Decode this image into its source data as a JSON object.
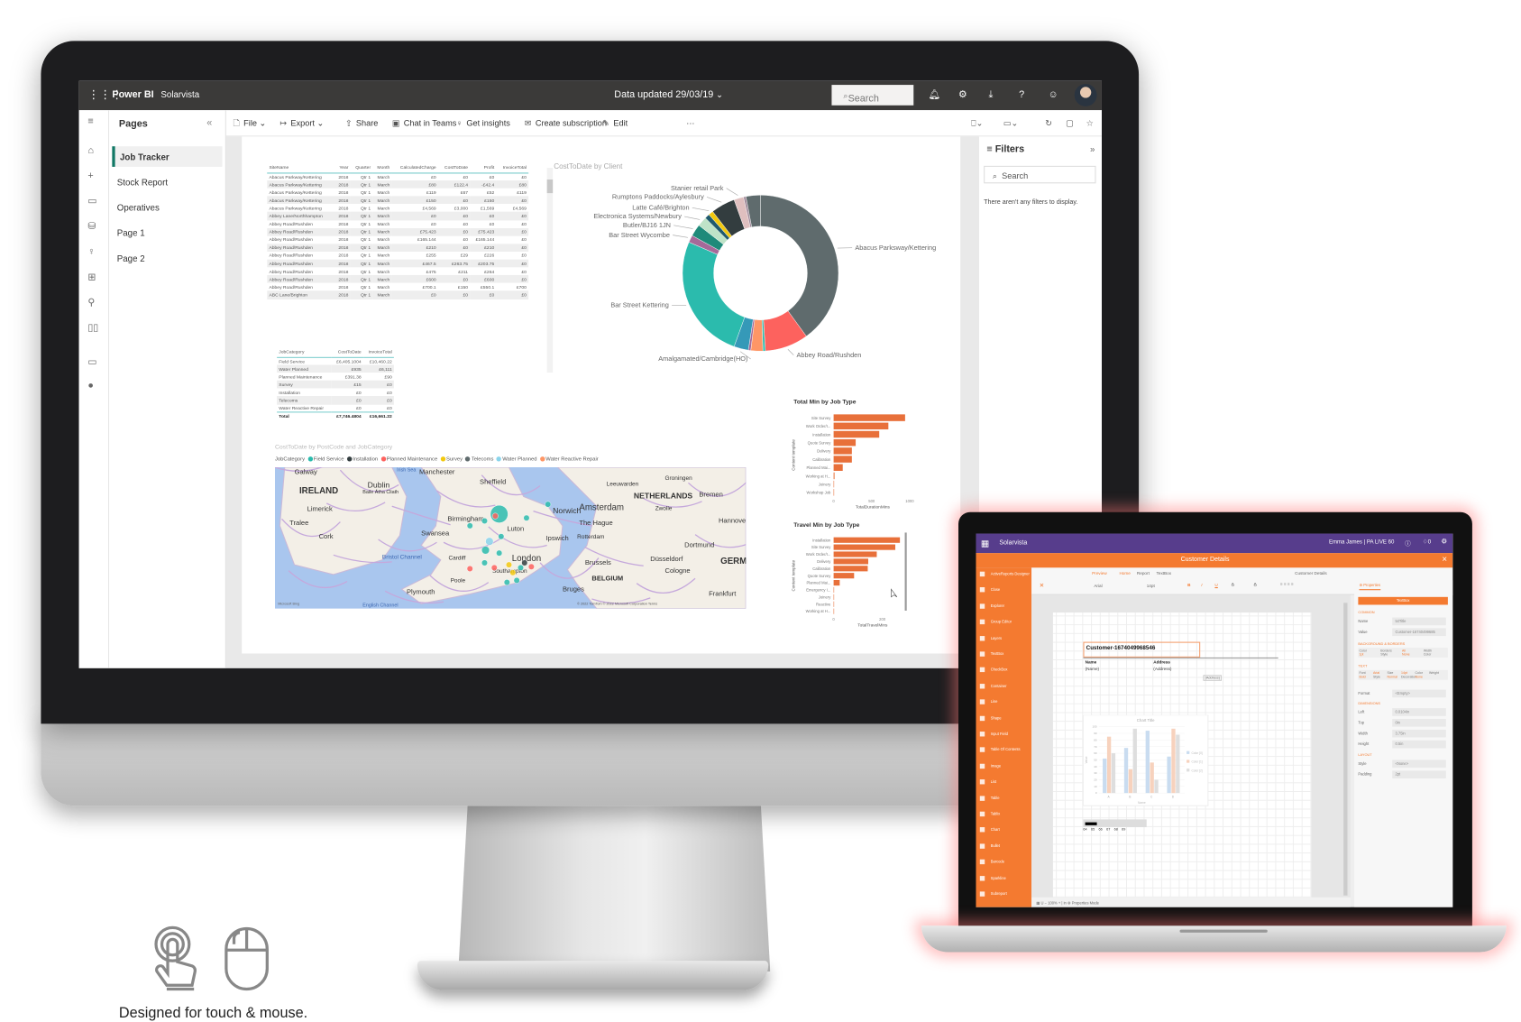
{
  "monitor": {
    "topbar": {
      "grid_icon": "waffle-icon",
      "brand": "Power BI",
      "workspace": "Solarvista",
      "data_updated": "Data updated 29/03/19",
      "search_placeholder": "Search",
      "icons": [
        "bell-icon",
        "gear-icon",
        "download-icon",
        "help-icon",
        "smiley-icon",
        "avatar"
      ]
    },
    "rail_icons": [
      "hamburger-icon",
      "home-icon",
      "plus-icon",
      "folder-icon",
      "database-icon",
      "lightbulb-icon",
      "apps-icon",
      "rocket-icon",
      "book-icon",
      "monitor-icon",
      "user-circle-icon"
    ],
    "pages": {
      "title": "Pages",
      "collapse": "«",
      "items": [
        {
          "label": "Job Tracker",
          "selected": true
        },
        {
          "label": "Stock Report"
        },
        {
          "label": "Operatives"
        },
        {
          "label": "Page 1"
        },
        {
          "label": "Page 2"
        }
      ]
    },
    "toolbar": {
      "items": [
        {
          "icon": "file-icon",
          "label": "File ⌄"
        },
        {
          "icon": "export-icon",
          "label": "Export ⌄"
        },
        {
          "icon": "share-icon",
          "label": "Share"
        },
        {
          "icon": "teams-icon",
          "label": "Chat in Teams"
        },
        {
          "icon": "lightbulb-icon",
          "label": "Get insights"
        },
        {
          "icon": "mail-icon",
          "label": "Create subscription"
        },
        {
          "icon": "pencil-icon",
          "label": "Edit"
        },
        {
          "icon": "more-icon",
          "label": "···"
        }
      ],
      "right_icons": [
        "bookmark-icon",
        "view-icon",
        "refresh-icon",
        "comment-icon",
        "star-icon"
      ]
    },
    "filters": {
      "title": "Filters",
      "expand": "»",
      "search_placeholder": "Search",
      "empty": "There aren't any filters to display."
    },
    "site_table": {
      "columns": [
        "SiteName",
        "Year",
        "Quarter",
        "Month",
        "CalculatedCharge",
        "CostToDate",
        "Profit",
        "InvoiceTotal"
      ],
      "rows": [
        [
          "Abacus Parkway/Kettering",
          "2018",
          "Qtr 1",
          "March",
          "£0",
          "£0",
          "£0",
          "£0"
        ],
        [
          "Abacus Parkway/Kettering",
          "2018",
          "Qtr 1",
          "March",
          "£80",
          "£122.4",
          "-£42.4",
          "£80"
        ],
        [
          "Abacus Parkway/Kettering",
          "2018",
          "Qtr 1",
          "March",
          "£119",
          "£67",
          "£52",
          "£119"
        ],
        [
          "Abacus Parkway/Kettering",
          "2018",
          "Qtr 1",
          "March",
          "£150",
          "£0",
          "£150",
          "£0"
        ],
        [
          "Abacus Parkway/Kettering",
          "2018",
          "Qtr 1",
          "March",
          "£4,569",
          "£3,000",
          "£1,569",
          "£4,569"
        ],
        [
          "Abbey Lane/Northhampton",
          "2018",
          "Qtr 1",
          "March",
          "£0",
          "£0",
          "£0",
          "£0"
        ],
        [
          "Abbey Road/Rushden",
          "2018",
          "Qtr 1",
          "March",
          "£0",
          "£0",
          "£0",
          "£0"
        ],
        [
          "Abbey Road/Rushden",
          "2018",
          "Qtr 1",
          "March",
          "£75.423",
          "£0",
          "£75.423",
          "£0"
        ],
        [
          "Abbey Road/Rushden",
          "2018",
          "Qtr 1",
          "March",
          "£165.144",
          "£0",
          "£165.144",
          "£0"
        ],
        [
          "Abbey Road/Rushden",
          "2018",
          "Qtr 1",
          "March",
          "£210",
          "£0",
          "£210",
          "£0"
        ],
        [
          "Abbey Road/Rushden",
          "2018",
          "Qtr 1",
          "March",
          "£255",
          "£29",
          "£226",
          "£0"
        ],
        [
          "Abbey Road/Rushden",
          "2018",
          "Qtr 1",
          "March",
          "£467.5",
          "£263.75",
          "£203.75",
          "£0"
        ],
        [
          "Abbey Road/Rushden",
          "2018",
          "Qtr 1",
          "March",
          "£475",
          "£211",
          "£264",
          "£0"
        ],
        [
          "Abbey Road/Rushden",
          "2018",
          "Qtr 1",
          "March",
          "£600",
          "£0",
          "£600",
          "£0"
        ],
        [
          "Abbey Road/Rushden",
          "2018",
          "Qtr 1",
          "March",
          "£700.1",
          "£150",
          "£550.1",
          "£700"
        ],
        [
          "ABC Lane/Brighton",
          "2018",
          "Qtr 1",
          "March",
          "£0",
          "£0",
          "£0",
          "£0"
        ]
      ]
    },
    "category_table": {
      "columns": [
        "JobCategory",
        "CostToDate",
        "InvoiceTotal"
      ],
      "rows": [
        [
          "Field Service",
          "£6,405.1004",
          "£10,460.22"
        ],
        [
          "Water Planned",
          "£935",
          "£6,111"
        ],
        [
          "Planned Maintenance",
          "£391.38",
          "£90"
        ],
        [
          "Survey",
          "£15",
          "£0"
        ],
        [
          "Installation",
          "£0",
          "£0"
        ],
        [
          "Telecoms",
          "£0",
          "£0"
        ],
        [
          "Water Reactive Repair",
          "£0",
          "£0"
        ]
      ],
      "total": [
        "Total",
        "£7,746.4804",
        "£16,661.22"
      ]
    },
    "map": {
      "title": "CostToDate by PostCode and JobCategory",
      "legend_title": "JobCategory",
      "legend": [
        {
          "label": "Field Service",
          "color": "#2bbbad"
        },
        {
          "label": "Installation",
          "color": "#333d3f"
        },
        {
          "label": "Planned Maintenance",
          "color": "#fd625e"
        },
        {
          "label": "Survey",
          "color": "#f2c80f"
        },
        {
          "label": "Telecoms",
          "color": "#5f6b6d"
        },
        {
          "label": "Water Planned",
          "color": "#8ad4eb"
        },
        {
          "label": "Water Reactive Repair",
          "color": "#fe9666"
        }
      ],
      "places": [
        "Galway",
        "IRELAND",
        "Dublin",
        "Baile Átha Cliath",
        "Limerick",
        "Tralee",
        "Cork",
        "Irish Sea",
        "Manchester",
        "Sheffield",
        "Birmingham",
        "Norwich",
        "Luton",
        "Ipswich",
        "Swansea",
        "Bristol Channel",
        "Cardiff",
        "London",
        "Southampton",
        "Poole",
        "Plymouth",
        "English Channel",
        "Leeuwarden",
        "Groningen",
        "NETHERLANDS",
        "Amsterdam",
        "The Hague",
        "Rotterdam",
        "Zwolle",
        "Bremen",
        "Hannover",
        "Dortmund",
        "Düsseldorf",
        "Bruges",
        "Brussels",
        "BELGIUM",
        "Cologne",
        "Frankfurt",
        "GERM"
      ],
      "attribution": "© 2022 TomTom © 2022 Microsoft Corporation  Terms",
      "logo": "Microsoft Bing"
    }
  },
  "chart_data": [
    {
      "type": "pie",
      "title": "CostToDate by Client",
      "donut": true,
      "slices": [
        {
          "label": "Abacus Parksway/Kettering",
          "value": 40,
          "color": "#5f6b6d"
        },
        {
          "label": "Abbey Road/Rushden",
          "value": 9,
          "color": "#fd625e"
        },
        {
          "label": "",
          "value": 0.5,
          "color": "#2bbbad"
        },
        {
          "label": "",
          "value": 2.5,
          "color": "#fe9666"
        },
        {
          "label": "",
          "value": 0.5,
          "color": "#a66999"
        },
        {
          "label": "Amalgamated/Cambridge(HO)",
          "value": 3,
          "color": "#3599b8"
        },
        {
          "label": "Bar Street Kettering",
          "value": 26,
          "color": "#2bbbad"
        },
        {
          "label": "Bar Street Wycombe",
          "value": 1.5,
          "color": "#a66999"
        },
        {
          "label": "Butler/BJ16 1JN",
          "value": 2.5,
          "color": "#1f8a7a"
        },
        {
          "label": "Electronica Systems/Newbury",
          "value": 2,
          "color": "#bfe3c8"
        },
        {
          "label": "",
          "value": 1,
          "color": "#205a6e"
        },
        {
          "label": "Latte Café/Brighton",
          "value": 1,
          "color": "#f2c80f"
        },
        {
          "label": "Rumptons Paddocks/Aylesbury",
          "value": 5,
          "color": "#333d3f"
        },
        {
          "label": "Stanier retail Park",
          "value": 2,
          "color": "#dfbfbf"
        },
        {
          "label": "",
          "value": 0.5,
          "color": "#a08a9a"
        },
        {
          "label": "",
          "value": 3,
          "color": "#5f6b6d"
        }
      ]
    },
    {
      "type": "bar",
      "orientation": "horizontal",
      "title": "Total Min by Job Type",
      "ylabel": "Content template",
      "xlabel": "TotalDurationMins",
      "xlim": [
        0,
        1000
      ],
      "xticks": [
        "0",
        "500",
        "1000"
      ],
      "color": "#e8703a",
      "categories": [
        "Site Survey",
        "Work Order/I...",
        "Installation",
        "Quote Survey",
        "Delivery",
        "Calibration",
        "Planned Mai...",
        "Working at H...",
        "Joinery",
        "Workshop Job"
      ],
      "values": [
        940,
        720,
        600,
        290,
        240,
        240,
        120,
        12,
        4,
        4
      ]
    },
    {
      "type": "bar",
      "orientation": "horizontal",
      "title": "Travel Min by Job Type",
      "ylabel": "Content template",
      "xlabel": "TotalTravelMins",
      "xlim": [
        0,
        270
      ],
      "xticks": [
        "0",
        "200"
      ],
      "color": "#e8703a",
      "categories": [
        "Installation",
        "Site Survey",
        "Work Order/I...",
        "Delivery",
        "Calibration",
        "Quote Survey",
        "Planned Mai...",
        "Emergency I...",
        "Joinery",
        "Reactive",
        "Working at H..."
      ],
      "values": [
        272,
        253,
        177,
        142,
        140,
        84,
        25,
        2,
        1,
        1,
        0
      ]
    },
    {
      "type": "bar",
      "title": "Chart Title",
      "xlabel": "Name",
      "ylabel": "Value",
      "ylim": [
        0,
        100
      ],
      "yticks": [
        "0",
        "10",
        "20",
        "30",
        "40",
        "50",
        "60",
        "70",
        "80",
        "90",
        "100"
      ],
      "categories": [
        "A",
        "B",
        "C",
        "D"
      ],
      "series": [
        {
          "name": "Color [0]",
          "values": [
            52,
            68,
            94,
            55
          ],
          "color": "#c9dcf0"
        },
        {
          "name": "Color [1]",
          "values": [
            85,
            36,
            46,
            97
          ],
          "color": "#f7d2bd"
        },
        {
          "name": "Color [2]",
          "values": [
            60,
            97,
            20,
            88
          ],
          "color": "#dedede"
        }
      ]
    }
  ],
  "laptop": {
    "header": {
      "brand": "Solarvista",
      "user": "Emma James | PA LIVE 60",
      "help": "?",
      "notifications": "0"
    },
    "dialog_title": "Customer Details",
    "close": "×",
    "sidebar": [
      "ActiveReports Designer",
      "Close",
      "Explorer",
      "Group Editor",
      "Layers",
      "TextBox",
      "CheckBox",
      "Container",
      "Line",
      "Shape",
      "Input Field",
      "Table Of Contents",
      "Image",
      "List",
      "Table",
      "Tablix",
      "Chart",
      "Bullet",
      "Barcode",
      "Sparkline",
      "Subreport"
    ],
    "tabs": [
      "Preview",
      "Home",
      "Report",
      "TextBox"
    ],
    "doc_title": "Customer Details",
    "toolbar": {
      "font": "Arial",
      "size": "14pt",
      "bold": "B",
      "italic": "I",
      "underline": "U"
    },
    "report": {
      "title": "Customer-1674049968546",
      "col1": "Name",
      "col1_val": "(Name)",
      "col2": "Address",
      "col2_val": "(Address)",
      "tooltip": "(Address)",
      "barcode": [
        "64",
        "65",
        "66",
        "67",
        "68",
        "69"
      ]
    },
    "status": {
      "zoom": "100%",
      "unit": "in",
      "mode": "Properties Mode"
    },
    "properties": {
      "tab": "Properties",
      "search": "TextBox",
      "common": "COMMON",
      "name_label": "Name",
      "name": "txtTitle",
      "value_label": "Value",
      "value": "Customer-16740499685",
      "bg": "BACKGROUND & BORDERS",
      "bg_cells": [
        "Color",
        "Borders",
        "All",
        "Width",
        "1pt",
        "Style",
        "None",
        "Color"
      ],
      "text": "TEXT",
      "text_cells": [
        "Font",
        "Arial",
        "Size",
        "14pt",
        "Color",
        "Weight",
        "Bold",
        "Style",
        "Normal",
        "Decoration",
        "None"
      ],
      "format_label": "Format",
      "format": "<Empty>",
      "dims": "DIMENSIONS",
      "dim_rows": [
        [
          "Left",
          "0.0104in"
        ],
        [
          "Top",
          "0in"
        ],
        [
          "Width",
          "3.75in"
        ],
        [
          "Height",
          "0.5in"
        ]
      ],
      "layout": "LAYOUT",
      "layout_rows": [
        [
          "Style",
          "<None>"
        ],
        [
          "Padding",
          "2pt"
        ]
      ]
    }
  },
  "tagline": "Designed for touch & mouse.",
  "tagline_icons": [
    "touch-hand-icon",
    "mouse-icon"
  ]
}
